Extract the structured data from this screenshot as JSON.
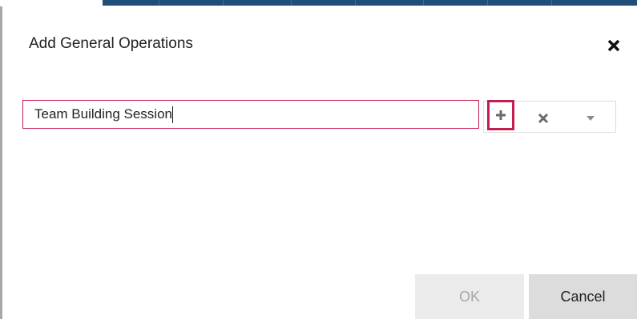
{
  "dialog": {
    "title": "Add General Operations",
    "close_icon": "close-icon"
  },
  "operation_input": {
    "value": "Team Building Session",
    "placeholder": ""
  },
  "toolbar": {
    "add_icon": "plus-icon",
    "clear_icon": "clear-x-icon",
    "dropdown_icon": "caret-down-icon"
  },
  "footer": {
    "ok_label": "OK",
    "ok_disabled": true,
    "cancel_label": "Cancel"
  },
  "colors": {
    "accent": "#c41e4e",
    "header_bar": "#1f4e79",
    "ok_bg": "#ebebeb",
    "cancel_bg": "#dcdcdc"
  }
}
